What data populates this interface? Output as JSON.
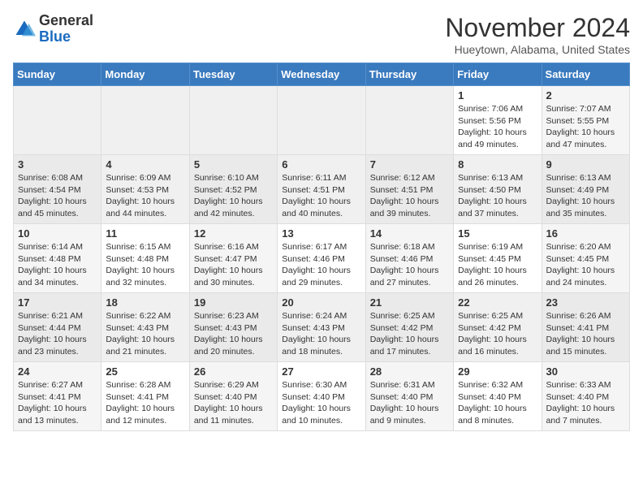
{
  "header": {
    "logo_general": "General",
    "logo_blue": "Blue",
    "month": "November 2024",
    "location": "Hueytown, Alabama, United States"
  },
  "weekdays": [
    "Sunday",
    "Monday",
    "Tuesday",
    "Wednesday",
    "Thursday",
    "Friday",
    "Saturday"
  ],
  "weeks": [
    [
      {
        "day": "",
        "info": ""
      },
      {
        "day": "",
        "info": ""
      },
      {
        "day": "",
        "info": ""
      },
      {
        "day": "",
        "info": ""
      },
      {
        "day": "",
        "info": ""
      },
      {
        "day": "1",
        "info": "Sunrise: 7:06 AM\nSunset: 5:56 PM\nDaylight: 10 hours and 49 minutes."
      },
      {
        "day": "2",
        "info": "Sunrise: 7:07 AM\nSunset: 5:55 PM\nDaylight: 10 hours and 47 minutes."
      }
    ],
    [
      {
        "day": "3",
        "info": "Sunrise: 6:08 AM\nSunset: 4:54 PM\nDaylight: 10 hours and 45 minutes."
      },
      {
        "day": "4",
        "info": "Sunrise: 6:09 AM\nSunset: 4:53 PM\nDaylight: 10 hours and 44 minutes."
      },
      {
        "day": "5",
        "info": "Sunrise: 6:10 AM\nSunset: 4:52 PM\nDaylight: 10 hours and 42 minutes."
      },
      {
        "day": "6",
        "info": "Sunrise: 6:11 AM\nSunset: 4:51 PM\nDaylight: 10 hours and 40 minutes."
      },
      {
        "day": "7",
        "info": "Sunrise: 6:12 AM\nSunset: 4:51 PM\nDaylight: 10 hours and 39 minutes."
      },
      {
        "day": "8",
        "info": "Sunrise: 6:13 AM\nSunset: 4:50 PM\nDaylight: 10 hours and 37 minutes."
      },
      {
        "day": "9",
        "info": "Sunrise: 6:13 AM\nSunset: 4:49 PM\nDaylight: 10 hours and 35 minutes."
      }
    ],
    [
      {
        "day": "10",
        "info": "Sunrise: 6:14 AM\nSunset: 4:48 PM\nDaylight: 10 hours and 34 minutes."
      },
      {
        "day": "11",
        "info": "Sunrise: 6:15 AM\nSunset: 4:48 PM\nDaylight: 10 hours and 32 minutes."
      },
      {
        "day": "12",
        "info": "Sunrise: 6:16 AM\nSunset: 4:47 PM\nDaylight: 10 hours and 30 minutes."
      },
      {
        "day": "13",
        "info": "Sunrise: 6:17 AM\nSunset: 4:46 PM\nDaylight: 10 hours and 29 minutes."
      },
      {
        "day": "14",
        "info": "Sunrise: 6:18 AM\nSunset: 4:46 PM\nDaylight: 10 hours and 27 minutes."
      },
      {
        "day": "15",
        "info": "Sunrise: 6:19 AM\nSunset: 4:45 PM\nDaylight: 10 hours and 26 minutes."
      },
      {
        "day": "16",
        "info": "Sunrise: 6:20 AM\nSunset: 4:45 PM\nDaylight: 10 hours and 24 minutes."
      }
    ],
    [
      {
        "day": "17",
        "info": "Sunrise: 6:21 AM\nSunset: 4:44 PM\nDaylight: 10 hours and 23 minutes."
      },
      {
        "day": "18",
        "info": "Sunrise: 6:22 AM\nSunset: 4:43 PM\nDaylight: 10 hours and 21 minutes."
      },
      {
        "day": "19",
        "info": "Sunrise: 6:23 AM\nSunset: 4:43 PM\nDaylight: 10 hours and 20 minutes."
      },
      {
        "day": "20",
        "info": "Sunrise: 6:24 AM\nSunset: 4:43 PM\nDaylight: 10 hours and 18 minutes."
      },
      {
        "day": "21",
        "info": "Sunrise: 6:25 AM\nSunset: 4:42 PM\nDaylight: 10 hours and 17 minutes."
      },
      {
        "day": "22",
        "info": "Sunrise: 6:25 AM\nSunset: 4:42 PM\nDaylight: 10 hours and 16 minutes."
      },
      {
        "day": "23",
        "info": "Sunrise: 6:26 AM\nSunset: 4:41 PM\nDaylight: 10 hours and 15 minutes."
      }
    ],
    [
      {
        "day": "24",
        "info": "Sunrise: 6:27 AM\nSunset: 4:41 PM\nDaylight: 10 hours and 13 minutes."
      },
      {
        "day": "25",
        "info": "Sunrise: 6:28 AM\nSunset: 4:41 PM\nDaylight: 10 hours and 12 minutes."
      },
      {
        "day": "26",
        "info": "Sunrise: 6:29 AM\nSunset: 4:40 PM\nDaylight: 10 hours and 11 minutes."
      },
      {
        "day": "27",
        "info": "Sunrise: 6:30 AM\nSunset: 4:40 PM\nDaylight: 10 hours and 10 minutes."
      },
      {
        "day": "28",
        "info": "Sunrise: 6:31 AM\nSunset: 4:40 PM\nDaylight: 10 hours and 9 minutes."
      },
      {
        "day": "29",
        "info": "Sunrise: 6:32 AM\nSunset: 4:40 PM\nDaylight: 10 hours and 8 minutes."
      },
      {
        "day": "30",
        "info": "Sunrise: 6:33 AM\nSunset: 4:40 PM\nDaylight: 10 hours and 7 minutes."
      }
    ]
  ]
}
